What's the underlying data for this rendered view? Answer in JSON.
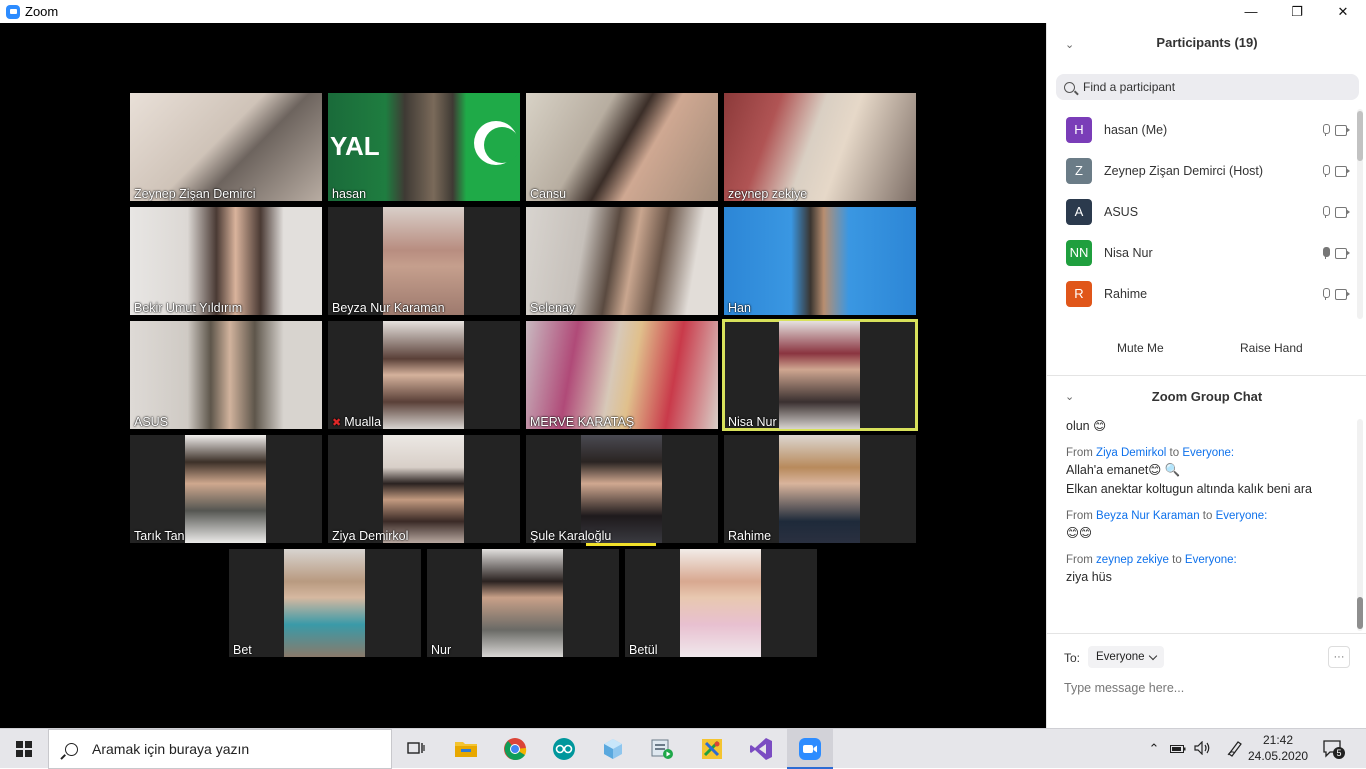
{
  "window": {
    "title": "Zoom",
    "minimize": "—",
    "restore": "❐",
    "close": "✕"
  },
  "video_tiles": [
    {
      "name": "Zeynep Zişan Demirci"
    },
    {
      "name": "hasan"
    },
    {
      "name": "Cansu"
    },
    {
      "name": "zeynep zekiye"
    },
    {
      "name": "Bekir Umut Yıldırım"
    },
    {
      "name": "Beyza Nur Karaman"
    },
    {
      "name": "Selenay"
    },
    {
      "name": "Han"
    },
    {
      "name": "ASUS"
    },
    {
      "name": "Mualla",
      "muted": true
    },
    {
      "name": "MERVE KARATAŞ"
    },
    {
      "name": "Nisa Nur",
      "active_speaker": true
    },
    {
      "name": "Tarık Tan"
    },
    {
      "name": "Ziya Demirkol"
    },
    {
      "name": "Şule Karaloğlu"
    },
    {
      "name": "Rahime"
    },
    {
      "name": "Bet"
    },
    {
      "name": "Nur"
    },
    {
      "name": "Betül"
    }
  ],
  "hasan_banner_text": "YAL",
  "participants": {
    "header": "Participants (19)",
    "search_placeholder": "Find a participant",
    "list": [
      {
        "initial": "H",
        "name": "hasan (Me)",
        "color": "#7a3db8"
      },
      {
        "initial": "Z",
        "name": "Zeynep Zişan Demirci (Host)",
        "color": "#6b7c87"
      },
      {
        "initial": "A",
        "name": "ASUS",
        "color": "#2b3a4d"
      },
      {
        "initial": "NN",
        "name": "Nisa Nur",
        "color": "#1f9f3e"
      },
      {
        "initial": "R",
        "name": "Rahime",
        "color": "#e0561a"
      }
    ],
    "mute_me": "Mute Me",
    "raise_hand": "Raise Hand"
  },
  "chat": {
    "header": "Zoom Group Chat",
    "messages": [
      {
        "text": "olun 😊"
      },
      {
        "from": "Ziya Demirkol",
        "to": "Everyone:",
        "lines": [
          "Allah'a emanet😊 🔍",
          "Elkan anektar koltugun altında kalık beni ara"
        ]
      },
      {
        "from": "Beyza Nur Karaman",
        "to": "Everyone:",
        "lines": [
          "😊😊"
        ]
      },
      {
        "from": "zeynep zekiye",
        "to": "Everyone:",
        "lines": [
          "ziya hüs"
        ]
      }
    ],
    "from_prefix": "From",
    "to_word": "to",
    "to_label": "To:",
    "to_value": "Everyone",
    "more": "···",
    "input_placeholder": "Type message here..."
  },
  "taskbar": {
    "search_text": "Aramak için buraya yazın",
    "time": "21:42",
    "date": "24.05.2020",
    "notification_count": "5",
    "apps": [
      "task-view-icon",
      "file-explorer-icon",
      "chrome-icon",
      "arduino-icon",
      "cube-app-icon",
      "media-app-icon",
      "gadget-app-icon",
      "visual-studio-icon",
      "zoom-icon"
    ]
  },
  "colors": {
    "active_speaker_outline": "#d8e15b",
    "link_blue": "#0e71eb",
    "zoom_blue": "#2d8cff"
  }
}
